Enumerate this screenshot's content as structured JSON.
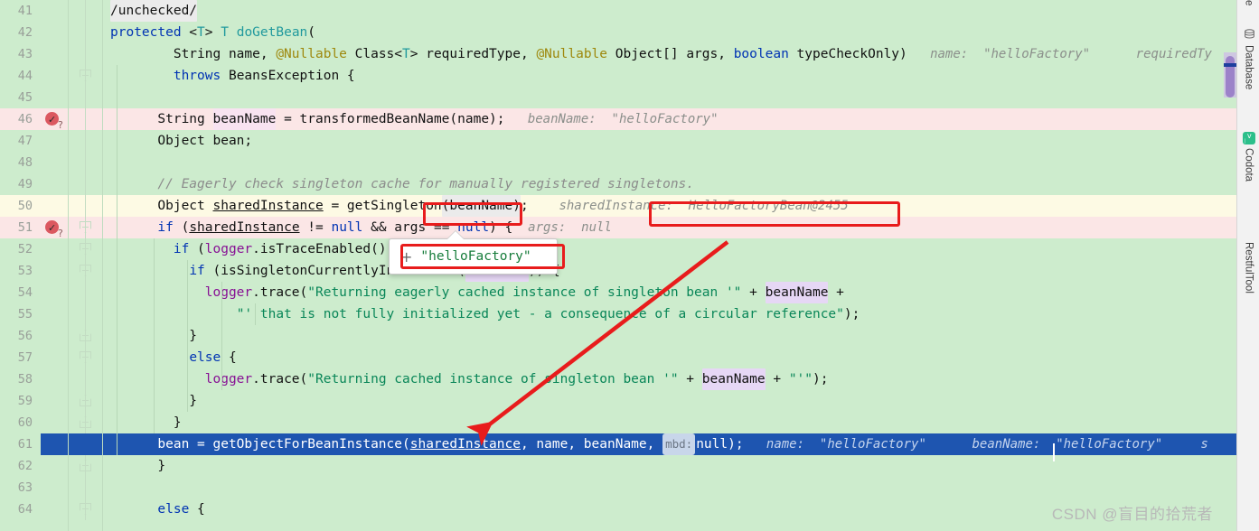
{
  "editor": {
    "language": "java",
    "first_line_number": 41,
    "colors": {
      "background": "#cdeccd",
      "breakpoint_line": "#fbe6e6",
      "execution_line": "#fdfae4",
      "selection": "#1e55b0",
      "keyword": "#0033b3",
      "string": "#098658",
      "comment": "#8c8c8c",
      "annotation": "#9e880d",
      "class_ref": "#20999d",
      "field": "#871094",
      "inline_hint": "#8b8f8b",
      "annotation_red": "#e81c1c"
    },
    "lines": [
      {
        "num": "41",
        "state": "normal",
        "fold": null,
        "breakpoint": false
      },
      {
        "num": "42",
        "state": "normal",
        "fold": null,
        "breakpoint": false
      },
      {
        "num": "43",
        "state": "normal",
        "fold": null,
        "breakpoint": false
      },
      {
        "num": "44",
        "state": "normal",
        "fold": "down",
        "breakpoint": false
      },
      {
        "num": "45",
        "state": "normal",
        "fold": null,
        "breakpoint": false
      },
      {
        "num": "46",
        "state": "bp",
        "fold": null,
        "breakpoint": true
      },
      {
        "num": "47",
        "state": "normal",
        "fold": null,
        "breakpoint": false
      },
      {
        "num": "48",
        "state": "normal",
        "fold": null,
        "breakpoint": false
      },
      {
        "num": "49",
        "state": "normal",
        "fold": null,
        "breakpoint": false
      },
      {
        "num": "50",
        "state": "exec",
        "fold": null,
        "breakpoint": false
      },
      {
        "num": "51",
        "state": "bp",
        "fold": "down",
        "breakpoint": true
      },
      {
        "num": "52",
        "state": "normal",
        "fold": "down",
        "breakpoint": false
      },
      {
        "num": "53",
        "state": "normal",
        "fold": "down",
        "breakpoint": false
      },
      {
        "num": "54",
        "state": "normal",
        "fold": null,
        "breakpoint": false
      },
      {
        "num": "55",
        "state": "normal",
        "fold": null,
        "breakpoint": false
      },
      {
        "num": "56",
        "state": "normal",
        "fold": "up",
        "breakpoint": false
      },
      {
        "num": "57",
        "state": "normal",
        "fold": "down",
        "breakpoint": false
      },
      {
        "num": "58",
        "state": "normal",
        "fold": null,
        "breakpoint": false
      },
      {
        "num": "59",
        "state": "normal",
        "fold": "up",
        "breakpoint": false
      },
      {
        "num": "60",
        "state": "normal",
        "fold": "up",
        "breakpoint": false
      },
      {
        "num": "61",
        "state": "sel",
        "fold": null,
        "breakpoint": false
      },
      {
        "num": "62",
        "state": "normal",
        "fold": "up",
        "breakpoint": false
      },
      {
        "num": "63",
        "state": "normal",
        "fold": null,
        "breakpoint": false
      },
      {
        "num": "64",
        "state": "normal",
        "fold": "down",
        "breakpoint": false
      }
    ],
    "code_text": {
      "l41": "/unchecked/",
      "l42": "protected <T> T doGetBean(",
      "l43": "String name, @Nullable Class<T> requiredType, @Nullable Object[] args, boolean typeCheckOnly)",
      "l44": "throws BeansException {",
      "l45": "",
      "l46": "String beanName = transformedBeanName(name);",
      "l47": "Object bean;",
      "l48": "",
      "l49": "// Eagerly check singleton cache for manually registered singletons.",
      "l50": "Object sharedInstance = getSingleton(beanName);",
      "l51": "if (sharedInstance != null && args == null) {",
      "l52": "if (logger.isTraceEnabled()) {",
      "l53": "if (isSingletonCurrentlyInCreation(beanName)) {",
      "l54": "logger.trace(\"Returning eagerly cached instance of singleton bean '\" + beanName +",
      "l55": "\"' that is not fully initialized yet - a consequence of a circular reference\");",
      "l56": "}",
      "l57": "else {",
      "l58": "logger.trace(\"Returning cached instance of singleton bean '\" + beanName + \"'\");",
      "l59": "}",
      "l60": "}",
      "l61": "bean = getObjectForBeanInstance(sharedInstance, name, beanName, mbd: null);",
      "l62": "}",
      "l63": "",
      "l64": "else {"
    },
    "inline_hints": {
      "l43_name": "name:  \"helloFactory\"",
      "l43_requiredtype": "requiredTy",
      "l46_beanname": "beanName:  \"helloFactory\"",
      "l50_sharedinstance": "sharedInstance:  HelloFactoryBean@2455",
      "l51_args": "args:  null",
      "l61_name": "name:  \"helloFactory\"",
      "l61_beanname": "beanName:  \"helloFactory\"",
      "l61_trailing": "s"
    },
    "param_badge_mbd": "mbd:"
  },
  "popup": {
    "expand_icon": "+",
    "value": "\"helloFactory\""
  },
  "right_strip": {
    "tabs": [
      {
        "label": "Database",
        "icon": "database-icon"
      },
      {
        "label": "Codota",
        "icon": "codota-icon"
      },
      {
        "label": "RestfulTool",
        "icon": "globe-icon"
      }
    ],
    "top_clipped_label": "e"
  },
  "watermark": {
    "text": "CSDN @盲目的拾荒者"
  }
}
